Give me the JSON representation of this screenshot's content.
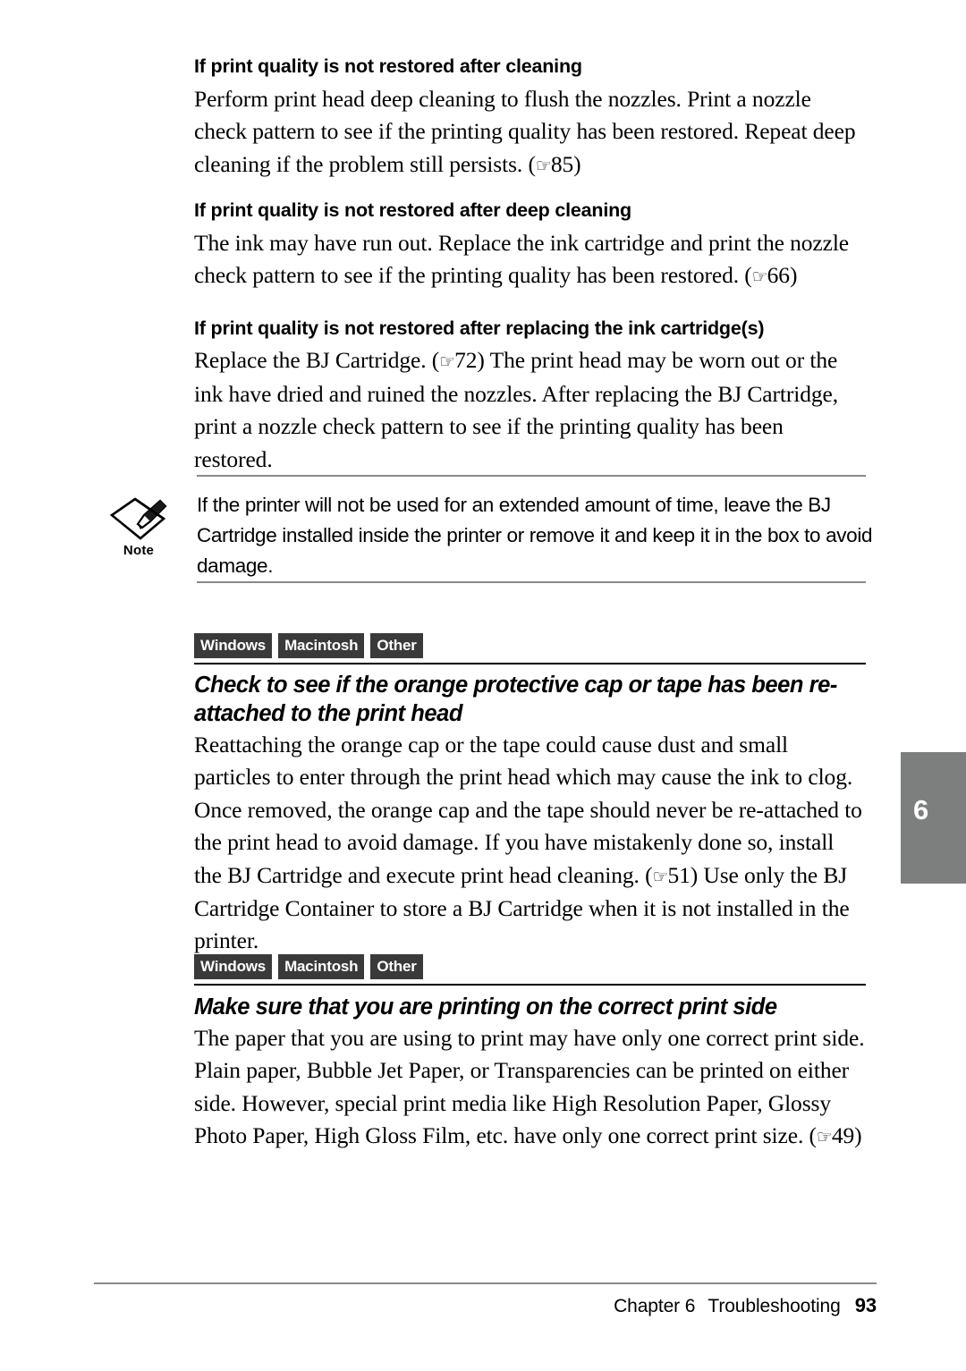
{
  "document": {
    "type": "printer user manual page",
    "chapter_tab_number": "6"
  },
  "sections": [
    {
      "heading": "If print quality is not restored after cleaning",
      "body": "Perform print head deep cleaning to flush the nozzles.  Print a nozzle check pattern to see if the printing quality has been restored.  Repeat deep cleaning if the problem still persists. (",
      "ref": "85",
      "body_tail": ")"
    },
    {
      "heading": "If print quality is not restored after deep cleaning",
      "body": "The ink may have run out.  Replace the ink cartridge and print the nozzle check pattern to see if the printing quality has been restored. (",
      "ref": "66",
      "body_tail": ")"
    },
    {
      "heading": "If print quality is not restored after replacing the ink cartridge(s)",
      "body": "Replace the BJ Cartridge. (",
      "ref": "72",
      "body_tail": ") The print head may be worn out or the ink have dried and ruined the nozzles.  After replacing the BJ Cartridge, print a nozzle check pattern to see if the printing quality has been restored."
    }
  ],
  "note": {
    "icon": "note-pencil-icon",
    "label": "Note",
    "text": "If the printer will not be used for an extended amount of time, leave the BJ Cartridge installed inside the printer or remove it and keep it in the box to avoid damage."
  },
  "platform_badges": [
    "Windows",
    "Macintosh",
    "Other"
  ],
  "topic_one": {
    "badges": [
      "Windows",
      "Macintosh",
      "Other"
    ],
    "heading": "Check to see if the orange protective cap or tape has been re-attached to the print head",
    "body": "Reattaching the orange cap or the tape could cause dust and small particles to enter through the print head which may cause the ink to clog.  Once removed, the orange cap and the tape should never be re-attached to the print head to avoid damage.  If you have mistakenly done so, install the BJ Cartridge and execute print head cleaning. (",
    "ref": "51",
    "body_tail": ") Use only the BJ Cartridge Container to store a BJ Cartridge when it is not installed in the printer."
  },
  "topic_two": {
    "badges": [
      "Windows",
      "Macintosh",
      "Other"
    ],
    "heading": "Make sure that you are printing on the correct print side",
    "body": "The paper that you are using to print may have only one correct print side. Plain paper, Bubble Jet Paper, or Transparencies can be printed on either side. However, special print media like High Resolution Paper, Glossy Photo Paper, High Gloss Film, etc. have only one correct print size. (",
    "ref": "49",
    "body_tail": ")"
  },
  "footer": {
    "chapter": "Chapter 6",
    "title": "Troubleshooting",
    "page_number": "93"
  },
  "colors": {
    "badge_background": "#3a3a3a",
    "chapter_tab": "#7d7f7e",
    "rule": "#8a8a8a",
    "text": "#000000"
  }
}
